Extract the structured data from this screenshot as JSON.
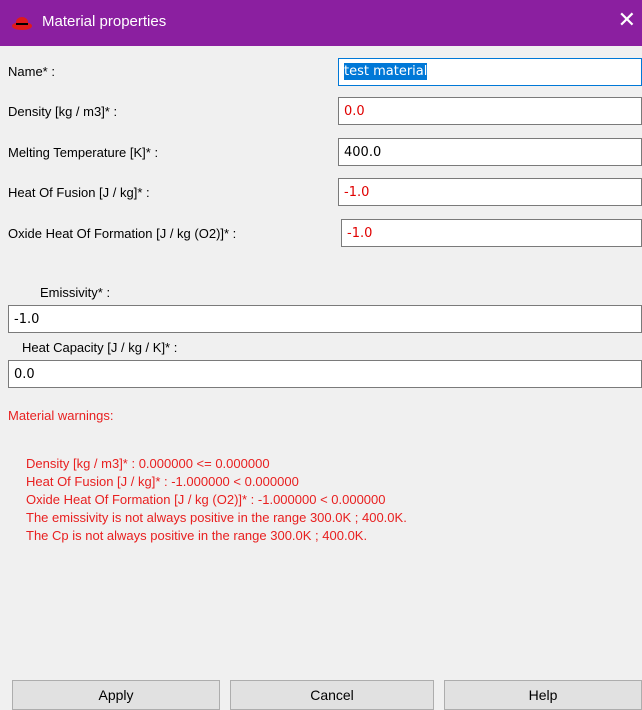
{
  "window": {
    "title": "Material properties",
    "close_glyph": "✕"
  },
  "fields": [
    {
      "label": "Name* :",
      "value": "test material"
    },
    {
      "label": "Density [kg / m3]* :",
      "value": "0.0"
    },
    {
      "label": "Melting Temperature [K]* :",
      "value": "400.0"
    },
    {
      "label": "Heat Of Fusion [J / kg]* :",
      "value": "-1.0"
    },
    {
      "label": "Oxide Heat Of Formation [J / kg (O2)]* :",
      "value": "-1.0"
    }
  ],
  "emissivity": {
    "label": "Emissivity* :",
    "value": "-1.0"
  },
  "heat_capacity": {
    "label": "Heat Capacity [J / kg / K]* :",
    "value": "0.0"
  },
  "warnings": {
    "title": "Material warnings:",
    "lines": [
      "Density [kg / m3]* : 0.000000 <= 0.000000",
      "Heat Of Fusion [J / kg]* : -1.000000 < 0.000000",
      "Oxide Heat Of Formation [J / kg (O2)]* : -1.000000 < 0.000000",
      "The emissivity is not always positive in the range 300.0K ; 400.0K.",
      "The Cp is not always positive in the range 300.0K ; 400.0K."
    ]
  },
  "buttons": {
    "apply": "Apply",
    "cancel": "Cancel",
    "help": "Help"
  },
  "colors": {
    "titlebar": "#8b1fa0",
    "warning_text": "#e82020",
    "invalid_value": "#e00000",
    "selection": "#0078d7"
  }
}
